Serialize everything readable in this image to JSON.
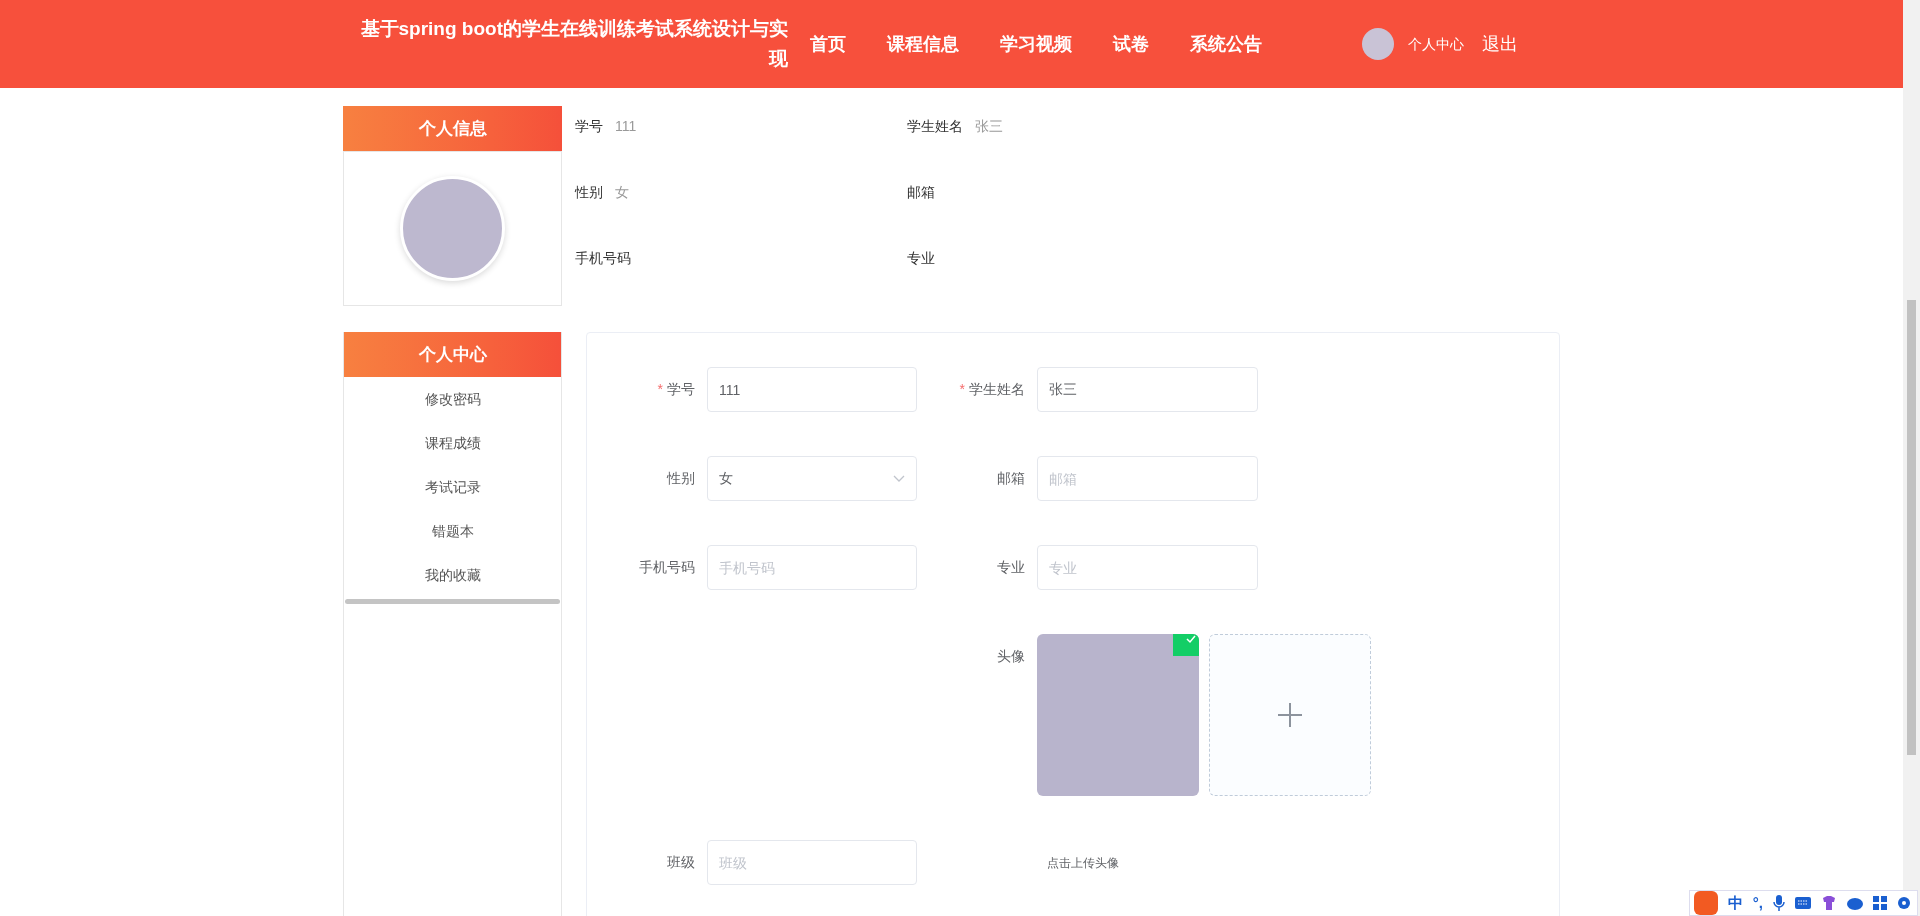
{
  "header": {
    "title": "基于spring boot的学生在线训练考试系统设计与实现",
    "nav": [
      "首页",
      "课程信息",
      "学习视频",
      "试卷",
      "系统公告"
    ],
    "user_menu": "个人中心",
    "logout": "退出"
  },
  "profile_panel": {
    "title": "个人信息",
    "fields": [
      {
        "label": "学号",
        "value": "111"
      },
      {
        "label": "学生姓名",
        "value": "张三"
      },
      {
        "label": "性别",
        "value": "女"
      },
      {
        "label": "邮箱"
      },
      {
        "label": "手机号码"
      },
      {
        "label": "专业"
      }
    ]
  },
  "sidebar": {
    "title": "个人中心",
    "items": [
      "修改密码",
      "课程成绩",
      "考试记录",
      "错题本",
      "我的收藏"
    ]
  },
  "form": {
    "required_mark": "*",
    "fields": [
      {
        "kind": "input",
        "label": "学号",
        "required": true,
        "value": "111"
      },
      {
        "kind": "input",
        "label": "学生姓名",
        "required": true,
        "value": "张三"
      },
      {
        "kind": "select",
        "label": "性别",
        "required": false,
        "value": "女"
      },
      {
        "kind": "input",
        "label": "邮箱",
        "required": false,
        "placeholder": "邮箱"
      },
      {
        "kind": "input",
        "label": "手机号码",
        "required": false,
        "placeholder": "手机号码"
      },
      {
        "kind": "input",
        "label": "专业",
        "required": false,
        "placeholder": "专业"
      },
      {
        "kind": "spacer"
      },
      {
        "kind": "upload",
        "label": "头像",
        "required": false,
        "uploaded": true
      },
      {
        "kind": "input",
        "label": "班级",
        "required": false,
        "placeholder": "班级"
      },
      {
        "kind": "hint",
        "text": "点击上传头像"
      }
    ]
  },
  "ime_toolbar": {
    "items": [
      "中",
      "°,"
    ]
  }
}
